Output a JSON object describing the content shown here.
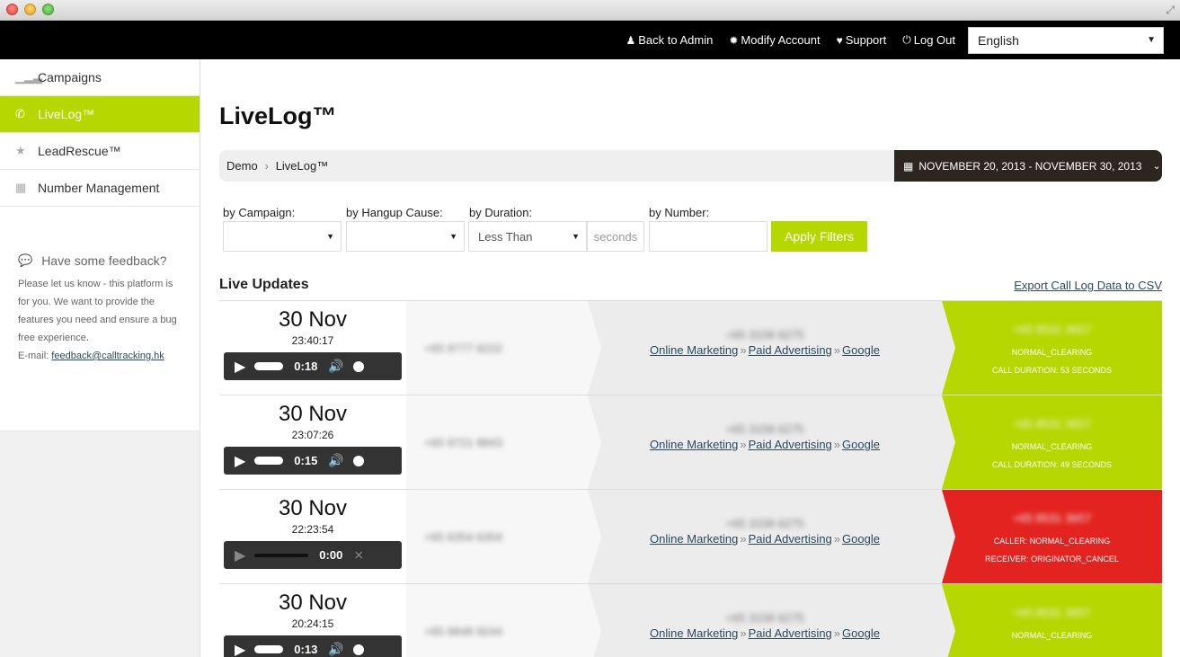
{
  "topbar": {
    "back_label": "Back to Admin",
    "modify_label": "Modify Account",
    "support_label": "Support",
    "logout_label": "Log Out",
    "language": "English"
  },
  "sidebar": {
    "items": [
      {
        "label": "Campaigns",
        "icon": "signal-bars-icon"
      },
      {
        "label": "LiveLog™",
        "icon": "phone-icon"
      },
      {
        "label": "LeadRescue™",
        "icon": "star-icon"
      },
      {
        "label": "Number Management",
        "icon": "grid-icon"
      }
    ],
    "feedback_title": "Have some feedback?",
    "feedback_text": "Please let us know - this platform is for you. We want to provide the features you need and ensure a bug free experience.",
    "feedback_email_prefix": "E-mail:",
    "feedback_email": "feedback@calltracking.hk"
  },
  "main": {
    "title": "LiveLog™",
    "breadcrumb": [
      "Demo",
      "LiveLog™"
    ],
    "date_range": "NOVEMBER 20, 2013 - NOVEMBER 30, 2013",
    "filters": {
      "campaign_label": "by Campaign:",
      "hangup_label": "by Hangup Cause:",
      "duration_label": "by Duration:",
      "duration_value": "Less Than",
      "seconds_label": "seconds",
      "number_label": "by Number:",
      "apply_label": "Apply Filters"
    },
    "live_updates_title": "Live Updates",
    "export_label": "Export Call Log Data to CSV"
  },
  "rows": [
    {
      "day": "30 Nov",
      "time": "23:40:17",
      "duration": "0:18",
      "caller": "+65 9777 6222",
      "tracking": "+65 3158 6275",
      "route": [
        "Online Marketing",
        "Paid Advertising",
        "Google"
      ],
      "status_num": "+65 8531 3657",
      "status_lines": [
        "NORMAL_CLEARING",
        "CALL DURATION: 53 SECONDS"
      ],
      "status": "green"
    },
    {
      "day": "30 Nov",
      "time": "23:07:26",
      "duration": "0:15",
      "caller": "+65 9721 8843",
      "tracking": "+65 3158 6275",
      "route": [
        "Online Marketing",
        "Paid Advertising",
        "Google"
      ],
      "status_num": "+65 8531 3657",
      "status_lines": [
        "NORMAL_CLEARING",
        "CALL DURATION: 49 SECONDS"
      ],
      "status": "green"
    },
    {
      "day": "30 Nov",
      "time": "22:23:54",
      "duration": "0:00",
      "caller": "+65 6354 6354",
      "tracking": "+65 3158 6275",
      "route": [
        "Online Marketing",
        "Paid Advertising",
        "Google"
      ],
      "status_num": "+65 8531 3657",
      "status_lines": [
        "CALLER: NORMAL_CLEARING",
        "RECEIVER: ORIGINATOR_CANCEL"
      ],
      "status": "red"
    },
    {
      "day": "30 Nov",
      "time": "20:24:15",
      "duration": "0:13",
      "caller": "+65 6848 9244",
      "tracking": "+65 3158 6275",
      "route": [
        "Online Marketing",
        "Paid Advertising",
        "Google"
      ],
      "status_num": "+65 8531 3657",
      "status_lines": [
        "NORMAL_CLEARING",
        ""
      ],
      "status": "green"
    }
  ],
  "colors": {
    "accent": "#b7d700",
    "error": "#e3231f",
    "dark": "#2c2520"
  }
}
